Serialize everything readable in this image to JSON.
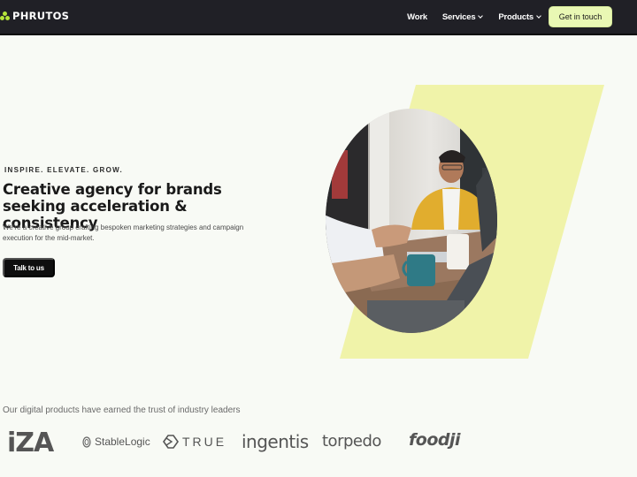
{
  "colors": {
    "nav_bg": "#202026",
    "accent": "#e9f8b4",
    "brand_green": "#b5e43a",
    "parallelogram": "#f0f3a9",
    "page_bg": "#f8faf5"
  },
  "nav": {
    "brand": "PHRUTOS",
    "brand_icon": "trefoil-dots-icon",
    "links": [
      {
        "label": "Work",
        "has_dropdown": false
      },
      {
        "label": "Services",
        "has_dropdown": true
      },
      {
        "label": "Products",
        "has_dropdown": true
      }
    ],
    "cta_label": "Get in touch"
  },
  "hero": {
    "tagline": "INSPIRE. ELEVATE. GROW.",
    "headline": "Creative agency for brands seeking acceleration & consistency",
    "subtext": "We're a creative group crafting bespoken marketing strategies and campaign execution for the mid-market.",
    "button_label": "Talk to us",
    "image_alt": "Team working at a table with laptops and coffee"
  },
  "trust": {
    "heading": "Our digital products have earned the trust of industry leaders",
    "logos": [
      {
        "name": "iza",
        "text": "iZA"
      },
      {
        "name": "stablelogic",
        "text": "StableLogic"
      },
      {
        "name": "true",
        "text": "TRUE"
      },
      {
        "name": "ingentis",
        "text": "ingentis"
      },
      {
        "name": "torpedo",
        "text": "torpedo"
      },
      {
        "name": "foodji",
        "text": "foodji"
      }
    ]
  }
}
